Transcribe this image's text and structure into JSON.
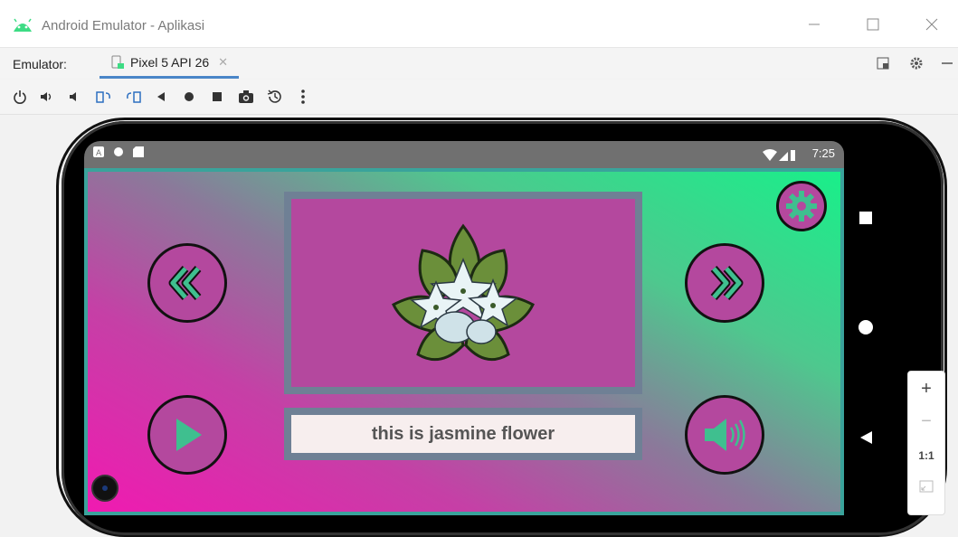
{
  "window": {
    "title": "Android Emulator - Aplikasi"
  },
  "tabbar": {
    "emulator_label": "Emulator:",
    "tab_label": "Pixel 5 API 26"
  },
  "statusbar": {
    "time": "7:25"
  },
  "app": {
    "caption": "this is jasmine flower"
  },
  "zoom": {
    "plus": "+",
    "minus": "−",
    "ratio": "1:1"
  },
  "colors": {
    "accent": "#4a86c8",
    "button_fill": "#b4489e",
    "icon_green": "#3fbf8f",
    "gradient_pink": "#f01ab1",
    "gradient_green": "#19ef8a",
    "frame": "#6f8095"
  }
}
